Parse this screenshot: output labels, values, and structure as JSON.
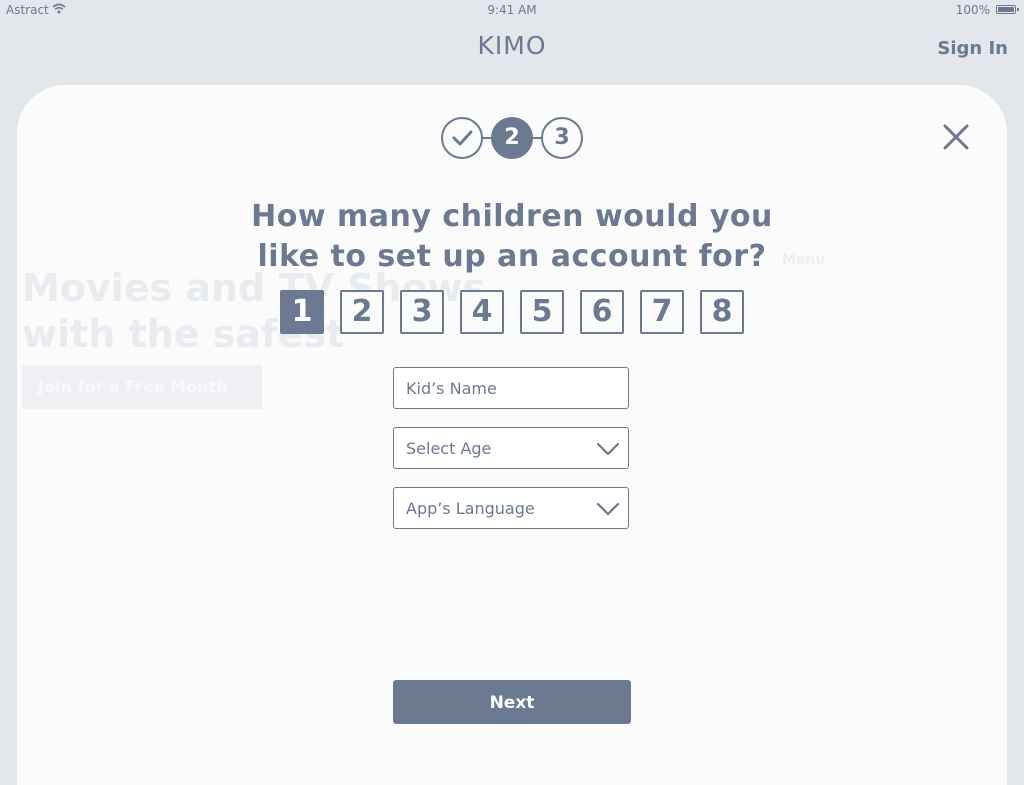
{
  "status_bar": {
    "carrier": "Astract",
    "time": "9:41 AM",
    "battery": "100%"
  },
  "header": {
    "logo": "KIMO",
    "sign_in_label": "Sign In"
  },
  "background": {
    "headline_line1": "Movies and TV Shows",
    "headline_line2": "with the safest",
    "cta_label": "Join for a Free Month",
    "menu_label": "Menu"
  },
  "wizard": {
    "steps": [
      {
        "label": "✓",
        "state": "completed"
      },
      {
        "label": "2",
        "state": "current"
      },
      {
        "label": "3",
        "state": "upcoming"
      }
    ],
    "question_line1": "How many children would you",
    "question_line2": "like to set up an account for?",
    "child_counts": [
      "1",
      "2",
      "3",
      "4",
      "5",
      "6",
      "7",
      "8"
    ],
    "selected_count": "1",
    "kid_name": {
      "placeholder": "Kid’s Name",
      "value": ""
    },
    "age_select": {
      "label": "Select Age"
    },
    "language_select": {
      "label": "App’s Language"
    },
    "next_label": "Next"
  },
  "colors": {
    "accent": "#6b7a91",
    "page_bg": "#e3e6eb",
    "modal_bg": "#fbfbfc"
  },
  "icons": {
    "close": "close-icon",
    "chevron": "chevron-down-icon",
    "check": "check-icon"
  }
}
